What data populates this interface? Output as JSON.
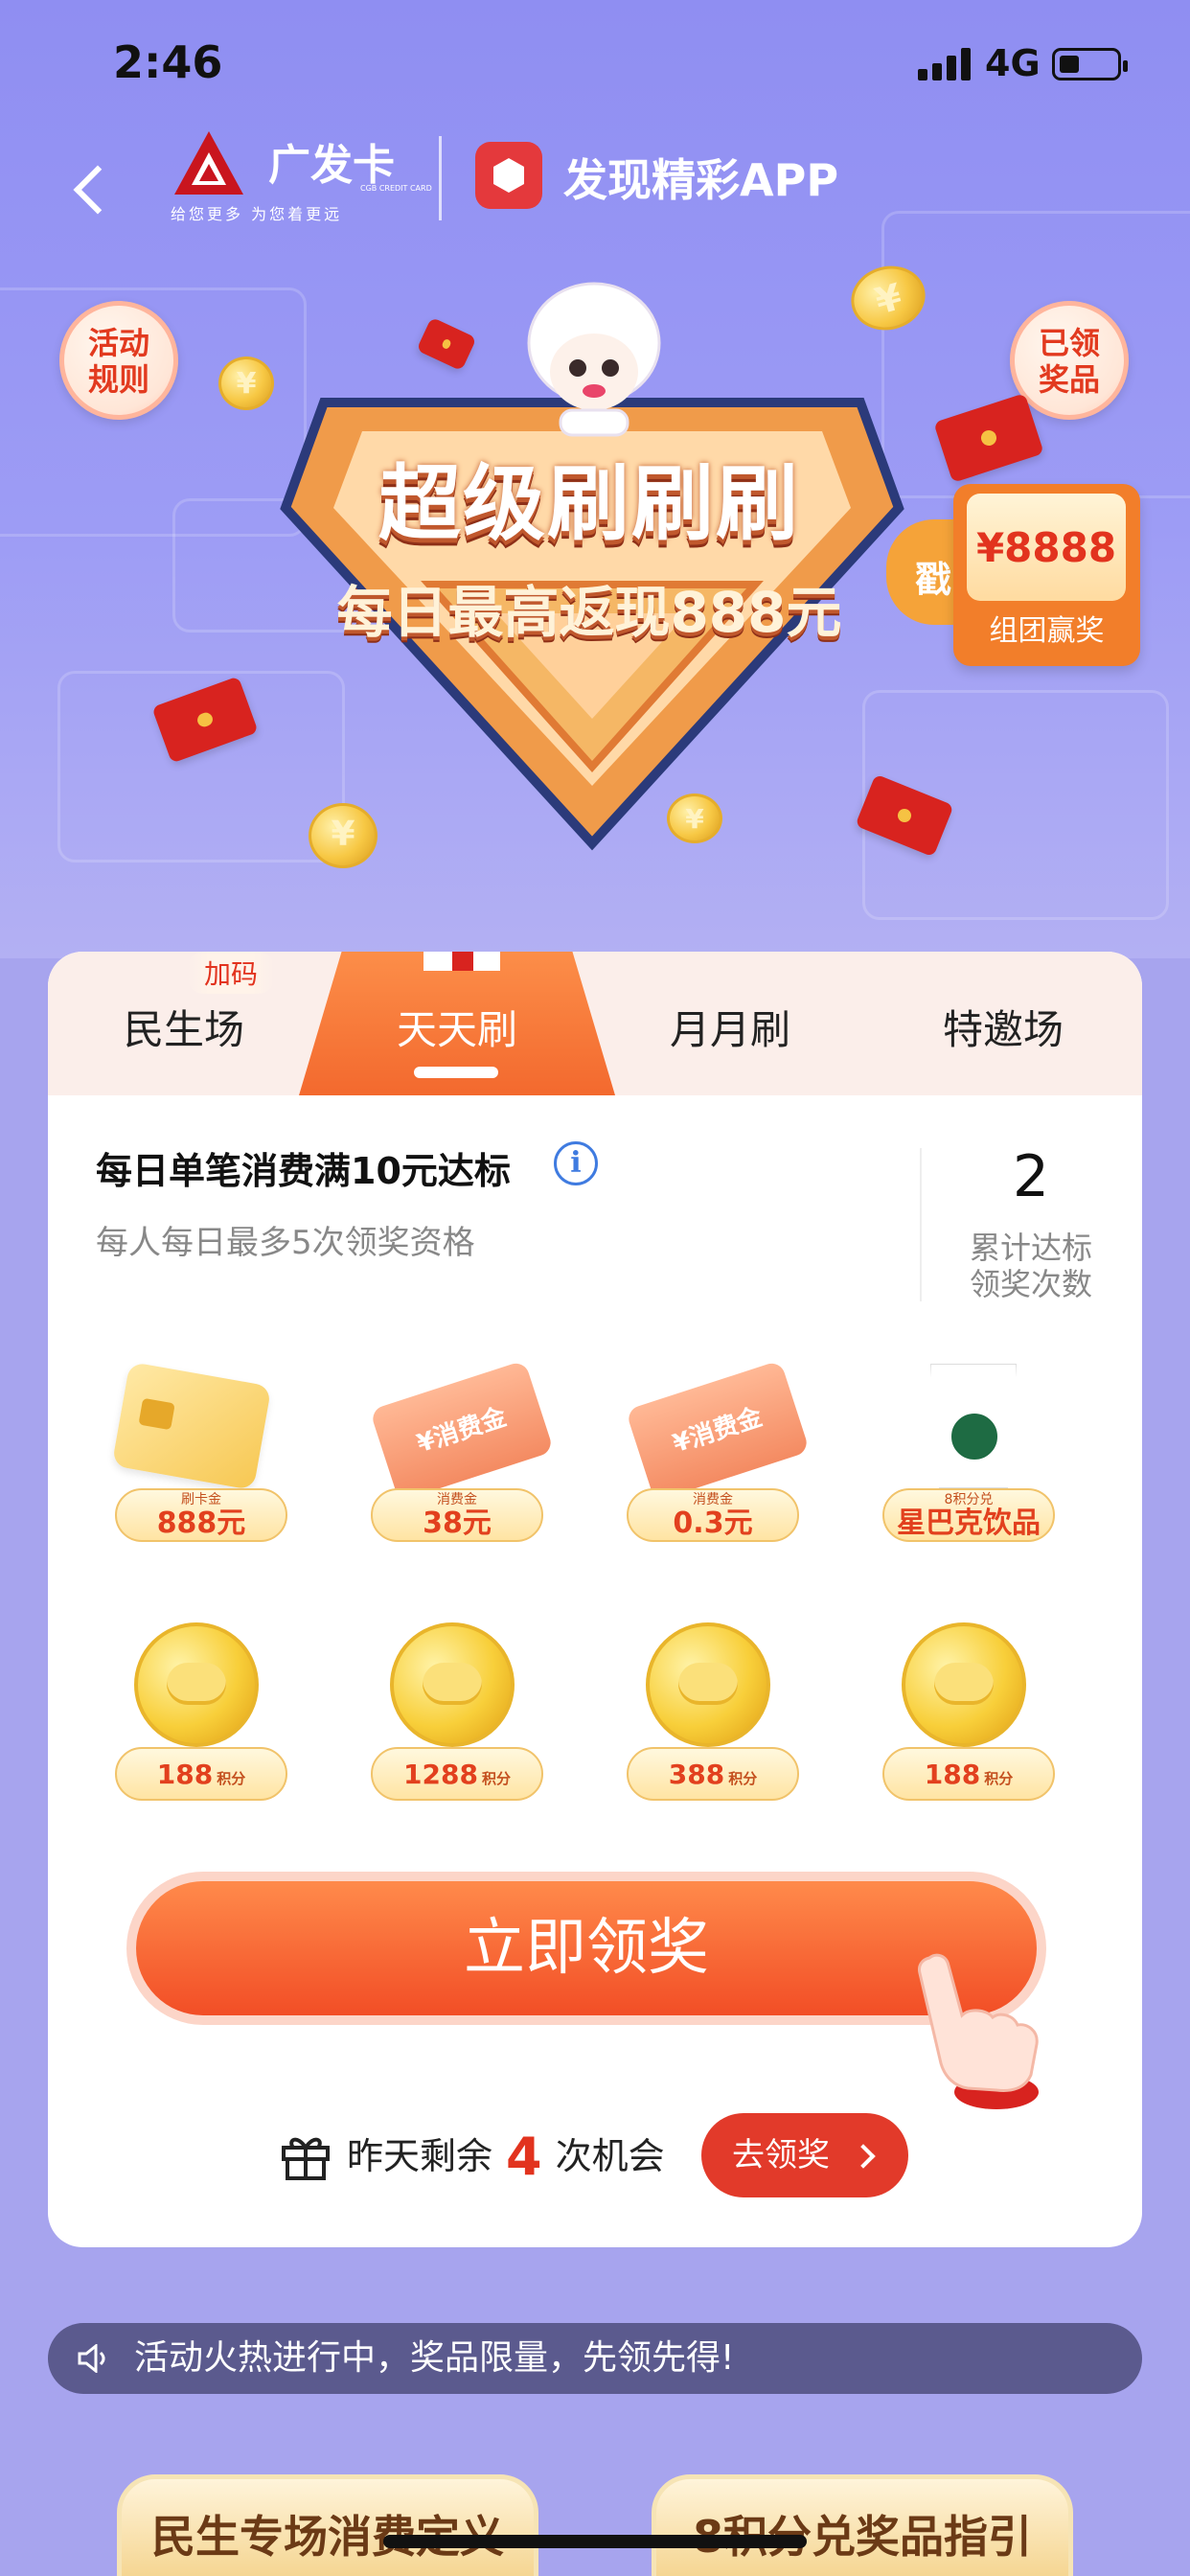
{
  "status": {
    "time": "2:46",
    "network": "4G"
  },
  "header": {
    "brand_name": "广发卡",
    "brand_slogan": "给您更多 为您着更远",
    "brand_sub": "CGB CREDIT CARD",
    "partner": "发现精彩APP"
  },
  "hero": {
    "rules_badge": "活动\n规则",
    "prizes_badge": "已领\n奖品",
    "title": "超级刷刷刷",
    "subtitle": "每日最高返现888元",
    "group_tag": "戳",
    "group_amount": "¥8888",
    "group_label": "组团赢奖"
  },
  "tabs": [
    {
      "label": "民生场",
      "badge": "加码"
    },
    {
      "label": "天天刷",
      "active": true
    },
    {
      "label": "月月刷"
    },
    {
      "label": "特邀场"
    }
  ],
  "rule": {
    "title": "每日单笔消费满10元达标",
    "info_icon": "i",
    "subtitle": "每人每日最多5次领奖资格",
    "count": "2",
    "count_label_1": "累计达标",
    "count_label_2": "领奖次数"
  },
  "prizes": [
    {
      "icon": "card",
      "top": "刷卡金",
      "value": "888元"
    },
    {
      "icon": "ticket",
      "ticket_text": "¥消费金",
      "top": "消费金",
      "value": "38元"
    },
    {
      "icon": "ticket",
      "ticket_text": "¥消费金",
      "top": "消费金",
      "value": "0.3元"
    },
    {
      "icon": "coffee-cup",
      "top": "8积分兑",
      "value": "星巴克饮品"
    },
    {
      "icon": "coin",
      "value": "188",
      "unit": "积分"
    },
    {
      "icon": "coin",
      "value": "1288",
      "unit": "积分"
    },
    {
      "icon": "coin",
      "value": "388",
      "unit": "积分"
    },
    {
      "icon": "coin",
      "value": "188",
      "unit": "积分"
    }
  ],
  "actions": {
    "claim_label": "立即领奖",
    "remain_prefix": "昨天剩余",
    "remain_count": "4",
    "remain_suffix": "次机会",
    "go_label": "去领奖"
  },
  "notice": {
    "text": "活动火热进行中，奖品限量，先领先得!"
  },
  "bottom_buttons": [
    "民生专场消费定义",
    "8积分兑奖品指引"
  ],
  "colors": {
    "accent": "#f24e26",
    "background": "#a7a4ee",
    "hero": "#8f8ef2"
  }
}
